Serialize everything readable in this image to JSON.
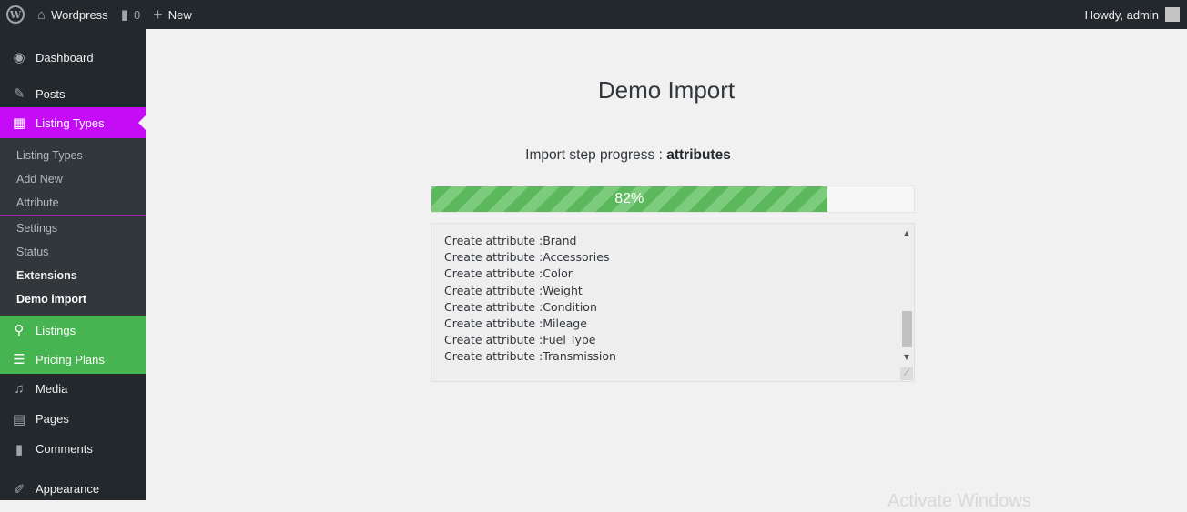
{
  "adminbar": {
    "site_name": "Wordpress",
    "comments_count": "0",
    "new_label": "New",
    "howdy": "Howdy, admin"
  },
  "sidebar": {
    "items_top": [
      {
        "label": "Dashboard",
        "icon": "dashboard-icon"
      },
      {
        "label": "Posts",
        "icon": "pin-icon"
      }
    ],
    "active_item": {
      "label": "Listing Types",
      "icon": "listing-types-icon"
    },
    "submenu": [
      "Listing Types",
      "Add New",
      "Attribute",
      "Settings",
      "Status",
      "Extensions",
      "Demo import"
    ],
    "items_green": [
      {
        "label": "Listings",
        "icon": "location-pin-icon"
      },
      {
        "label": "Pricing Plans",
        "icon": "list-icon"
      }
    ],
    "items_bottom": [
      {
        "label": "Media",
        "icon": "media-icon"
      },
      {
        "label": "Pages",
        "icon": "pages-icon"
      },
      {
        "label": "Comments",
        "icon": "comment-icon"
      },
      {
        "label": "Appearance",
        "icon": "brush-icon"
      }
    ]
  },
  "main": {
    "title": "Demo Import",
    "progress_prefix": "Import step progress : ",
    "progress_step": "attributes",
    "progress_percent": 82,
    "progress_text": "82%",
    "log_lines": [
      "Create attribute :Brand",
      "Create attribute :Accessories",
      "Create attribute :Color",
      "Create attribute :Weight",
      "Create attribute :Condition",
      "Create attribute :Mileage",
      "Create attribute :Fuel Type",
      "Create attribute :Transmission"
    ],
    "watermark": "Activate Windows"
  },
  "colors": {
    "active_menu": "#c40cf6",
    "green_menu": "#46b450",
    "progress": "#5cb85c"
  }
}
